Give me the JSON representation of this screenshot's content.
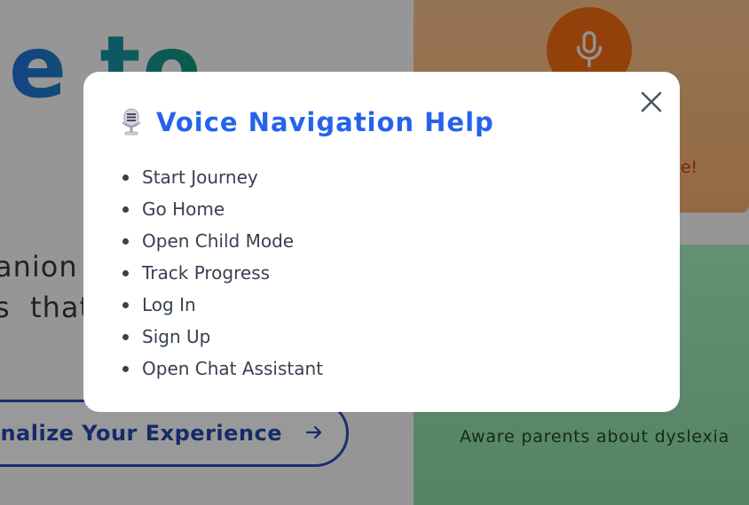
{
  "background": {
    "hero_title": "e to",
    "subtitle_line1": "anion",
    "subtitle_line2": "s  that",
    "cta_label": "sonalize Your Experience",
    "cta_icon": "arrow-right-icon",
    "voice_card": {
      "icon": "microphone-icon",
      "text": "e!",
      "accent": "#f56d12"
    },
    "info_card": {
      "text": "Aware parents about dyslexia"
    }
  },
  "modal": {
    "icon": "studio-microphone-icon",
    "title": "Voice Navigation Help",
    "close_icon": "close-icon",
    "commands": [
      "Start Journey",
      "Go Home",
      "Open Child Mode",
      "Track Progress",
      "Log In",
      "Sign Up",
      "Open Chat Assistant"
    ]
  },
  "colors": {
    "title_blue": "#2563eb",
    "text_gray": "#374151",
    "overlay": "rgba(0,0,0,0.40)"
  }
}
